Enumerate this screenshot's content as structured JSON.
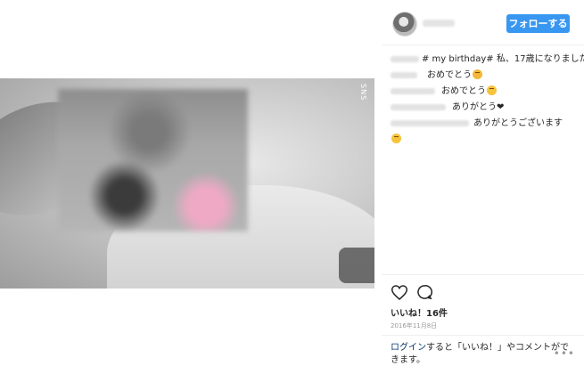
{
  "post": {
    "header": {
      "follow_label": "フォローする"
    },
    "caption": {
      "text": "# my birthday# 私、17歳になりました"
    },
    "comments": [
      {
        "text": "おめでとう"
      },
      {
        "text": "おめでとう"
      },
      {
        "text": "ありがとう❤"
      },
      {
        "text": "ありがとうございます"
      }
    ],
    "photo": {
      "vertical_label": "SNS"
    },
    "likes_label": "いいね！16件",
    "date": "2016年11月8日",
    "login_prompt": {
      "link": "ログイン",
      "rest": "すると「いいね！」やコメントができます。"
    },
    "more_label": "•••",
    "icons": [
      "heart-icon",
      "comment-icon",
      "more-options-icon"
    ]
  }
}
